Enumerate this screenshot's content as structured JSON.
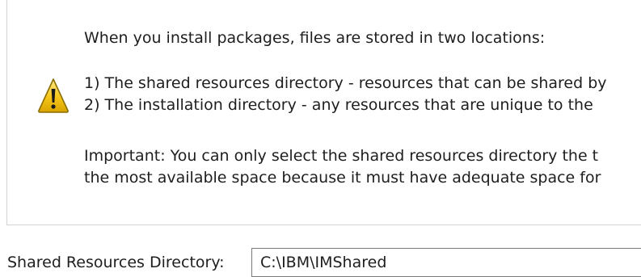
{
  "message": {
    "icon": "warning-icon",
    "intro": "When you install packages, files are stored in two locations:",
    "item1": "1) The shared resources directory - resources that can be shared by",
    "item2": "2) The installation directory - any resources that are unique to the",
    "important1": "Important: You can only select the shared resources directory the t",
    "important2": "the most available space because it must have adequate space for"
  },
  "shared_directory": {
    "label": "Shared Resources Directory:",
    "value": "C:\\IBM\\IMShared"
  },
  "colors": {
    "warning_fill": "#f5c518",
    "warning_stroke": "#8a6d00",
    "panel_border": "#d3d3d3",
    "input_border": "#7a7a7a",
    "text": "#1e1e1e"
  }
}
